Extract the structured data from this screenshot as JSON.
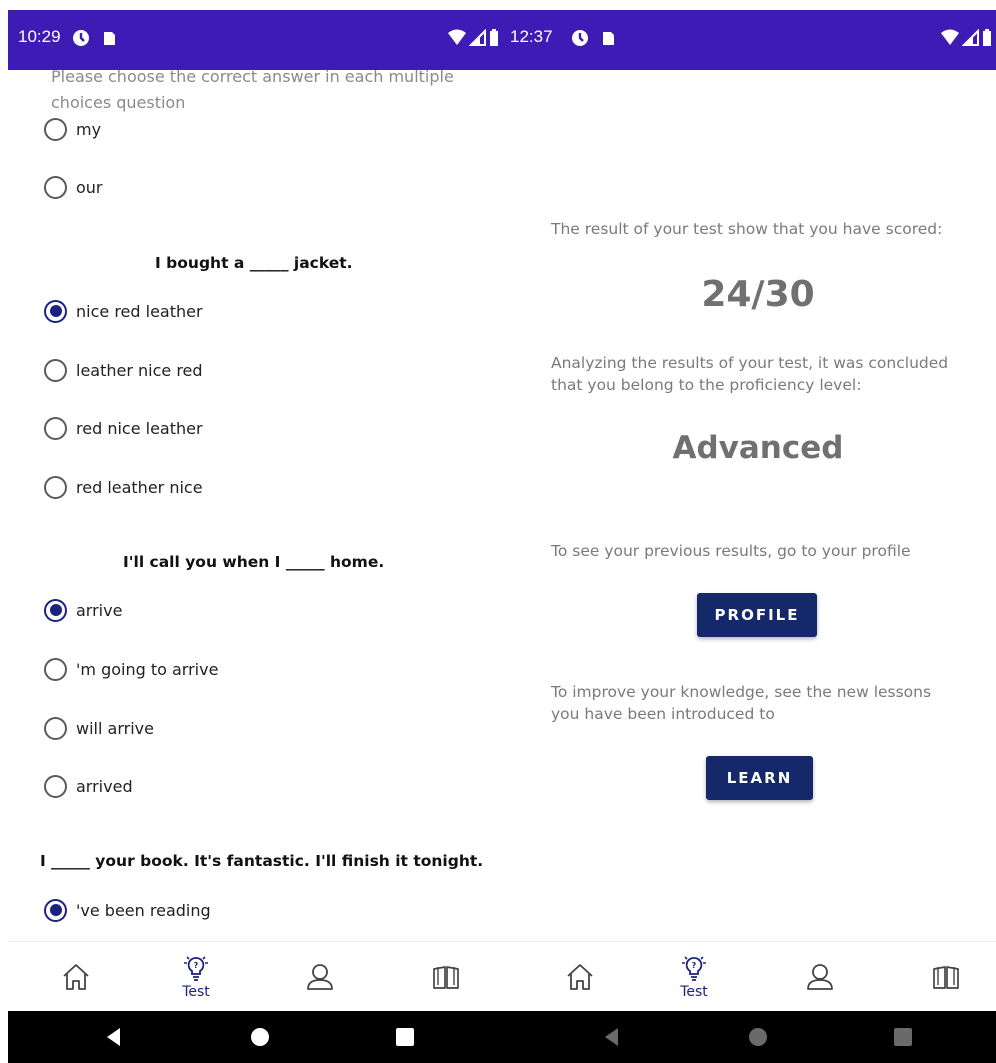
{
  "status_bar": {
    "left_time": "10:29",
    "right_time": "12:37",
    "background": "#3f1bb5"
  },
  "test_screen": {
    "instruction": "Please choose the correct answer in each multiple choices question",
    "prev_options": [
      "my",
      "our"
    ],
    "questions": [
      {
        "text": "I bought a _____ jacket.",
        "options": [
          "nice red leather",
          "leather nice red",
          "red nice leather",
          "red leather nice"
        ],
        "selected": 0
      },
      {
        "text": "I'll call you when I _____ home.",
        "options": [
          "arrive",
          "'m going to arrive",
          "will arrive",
          "arrived"
        ],
        "selected": 0
      },
      {
        "text": "I _____ your book. It's fantastic. I'll finish it tonight.",
        "options": [
          "'ve been reading"
        ],
        "selected": 0
      }
    ]
  },
  "result_screen": {
    "score_intro": "The result of your test show that you have scored:",
    "score": "24/30",
    "level_intro": "Analyzing the results of your test, it was concluded that you belong to the proficiency level:",
    "level": "Advanced",
    "profile_text": "To see your previous results, go to your profile",
    "profile_button": "PROFILE",
    "learn_text": "To improve your knowledge, see the new lessons you have been introduced to",
    "learn_button": "LEARN"
  },
  "bottom_nav": {
    "items": [
      {
        "icon": "home-icon",
        "label": ""
      },
      {
        "icon": "lightbulb-question-icon",
        "label": "Test",
        "active": true
      },
      {
        "icon": "person-icon",
        "label": ""
      },
      {
        "icon": "book-icon",
        "label": ""
      }
    ]
  },
  "colors": {
    "accent": "#1a237e",
    "button": "#14286a",
    "muted_text": "#7a7a7a"
  }
}
